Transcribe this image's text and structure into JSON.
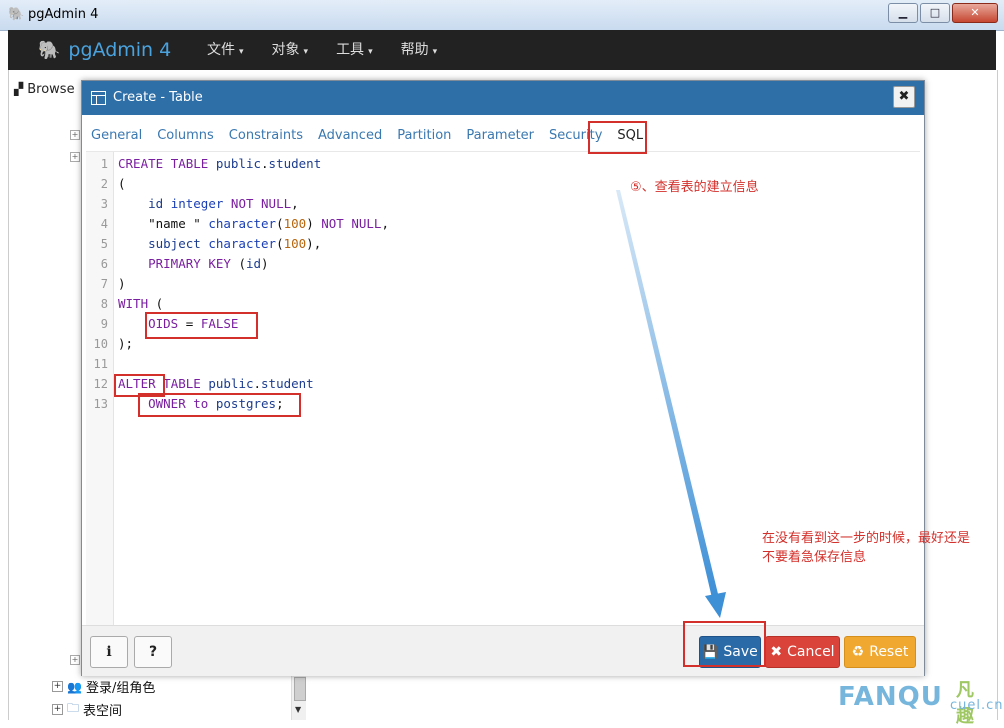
{
  "window": {
    "title": "pgAdmin 4",
    "minimize": "▁",
    "maximize": "□",
    "close": "✕"
  },
  "navbar": {
    "brand": "pgAdmin 4",
    "menus": [
      {
        "label": "文件",
        "caret": "▾"
      },
      {
        "label": "对象",
        "caret": "▾"
      },
      {
        "label": "工具",
        "caret": "▾"
      },
      {
        "label": "帮助",
        "caret": "▾"
      }
    ]
  },
  "browser": {
    "tab_label": "Browse",
    "tree_items": [
      {
        "label": "登录/组角色"
      },
      {
        "label": "表空间"
      }
    ]
  },
  "dialog": {
    "title": "Create - Table",
    "close_label": "✖",
    "tabs": [
      {
        "label": "General"
      },
      {
        "label": "Columns"
      },
      {
        "label": "Constraints"
      },
      {
        "label": "Advanced"
      },
      {
        "label": "Partition"
      },
      {
        "label": "Parameter"
      },
      {
        "label": "Security"
      },
      {
        "label": "SQL"
      }
    ],
    "active_tab": "SQL",
    "sql_lines": [
      {
        "n": "1",
        "text": "CREATE TABLE public.student"
      },
      {
        "n": "2",
        "text": "("
      },
      {
        "n": "3",
        "text": "    id integer NOT NULL,"
      },
      {
        "n": "4",
        "text": "    \"name \" character(100) NOT NULL,"
      },
      {
        "n": "5",
        "text": "    subject character(100),"
      },
      {
        "n": "6",
        "text": "    PRIMARY KEY (id)"
      },
      {
        "n": "7",
        "text": ")"
      },
      {
        "n": "8",
        "text": "WITH ("
      },
      {
        "n": "9",
        "text": "    OIDS = FALSE"
      },
      {
        "n": "10",
        "text": ");"
      },
      {
        "n": "11",
        "text": ""
      },
      {
        "n": "12",
        "text": "ALTER TABLE public.student"
      },
      {
        "n": "13",
        "text": "    OWNER to postgres;"
      }
    ],
    "buttons": {
      "info": "i",
      "help": "?",
      "save": "Save",
      "cancel": "Cancel",
      "reset": "Reset"
    }
  },
  "annotations": {
    "step_note": "⑤、查看表的建立信息",
    "advice_line1": "在没有看到这一步的时候，最好还是",
    "advice_line2": "不要着急保存信息",
    "color": "#d3302b",
    "arrow_color": "#3d8fd6"
  },
  "watermark": {
    "main": "FANQU",
    "sub": "cuel.cn",
    "cn": "凡趣"
  }
}
